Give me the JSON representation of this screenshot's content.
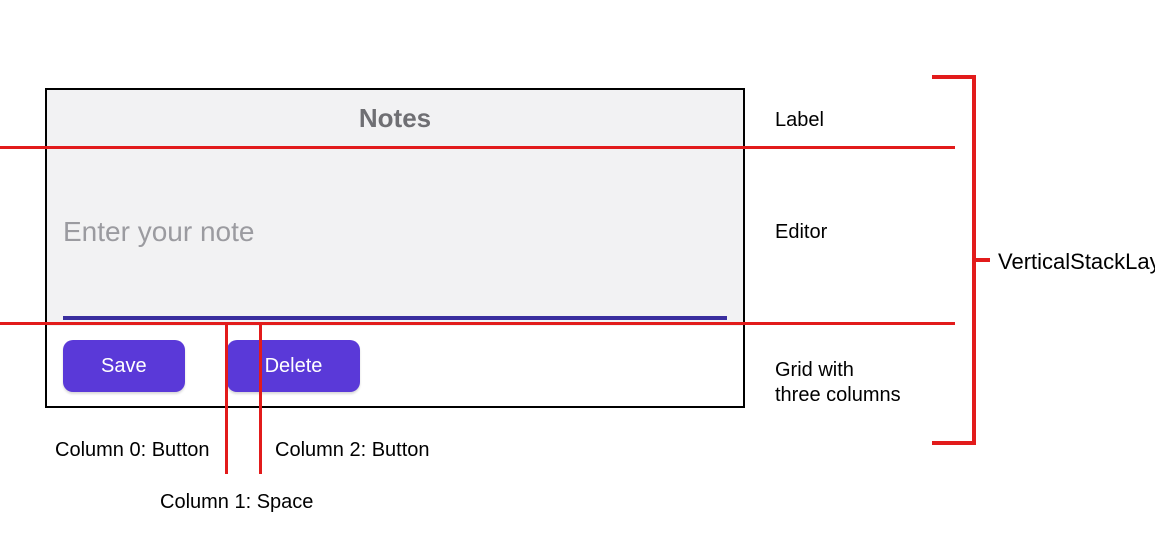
{
  "panel": {
    "title": "Notes",
    "editor_placeholder": "Enter your note",
    "save_label": "Save",
    "delete_label": "Delete"
  },
  "annotations": {
    "label": "Label",
    "editor": "Editor",
    "grid": "Grid with\nthree columns",
    "stack": "VerticalStackLayout",
    "col0": "Column 0: Button",
    "col1": "Column 1: Space",
    "col2": "Column 2: Button"
  }
}
